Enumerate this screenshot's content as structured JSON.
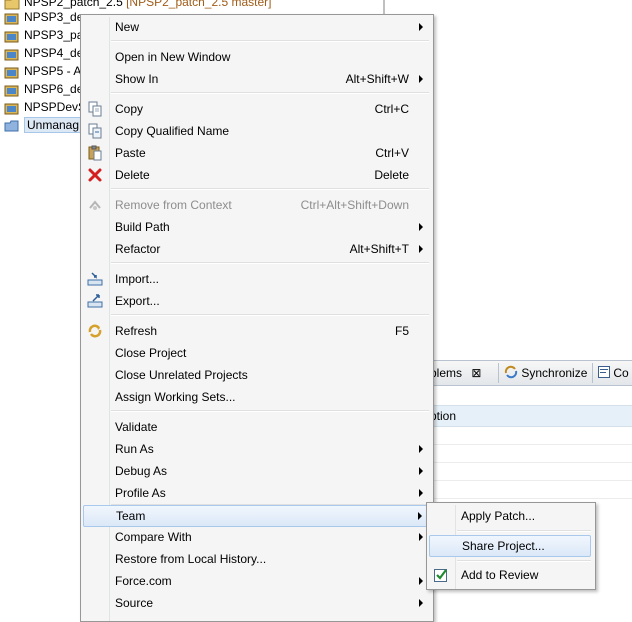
{
  "explorer": {
    "items": [
      {
        "label": "NPSP2_patch_2.5",
        "suffix": "[NPSP2_patch_2.5 master]"
      },
      {
        "label": "NPSP3_de"
      },
      {
        "label": "NPSP3_pa"
      },
      {
        "label": "NPSP4_de"
      },
      {
        "label": "NPSP5 - A"
      },
      {
        "label": "NPSP6_de"
      },
      {
        "label": "NPSPDevS"
      },
      {
        "label": "Unmanag"
      }
    ]
  },
  "bottom_panel": {
    "tabs": [
      {
        "label": "blems",
        "close": "⊠"
      },
      {
        "label": "Synchronize"
      },
      {
        "label": "Co"
      }
    ],
    "column_header": "ption"
  },
  "context_menu": {
    "items": [
      {
        "label": "New",
        "shortcut": "",
        "submenu": true
      },
      {
        "label": "Open in New Window",
        "shortcut": ""
      },
      {
        "label": "Show In",
        "shortcut": "Alt+Shift+W",
        "submenu": true
      },
      {
        "label": "Copy",
        "shortcut": "Ctrl+C",
        "icon": "copy-icon"
      },
      {
        "label": "Copy Qualified Name",
        "shortcut": "",
        "icon": "copy-qualified-name-icon"
      },
      {
        "label": "Paste",
        "shortcut": "Ctrl+V",
        "icon": "paste-icon"
      },
      {
        "label": "Delete",
        "shortcut": "Delete",
        "icon": "delete-icon"
      },
      {
        "label": "Remove from Context",
        "shortcut": "Ctrl+Alt+Shift+Down",
        "icon": "remove-context-icon",
        "disabled": true
      },
      {
        "label": "Build Path",
        "shortcut": "",
        "submenu": true
      },
      {
        "label": "Refactor",
        "shortcut": "Alt+Shift+T",
        "submenu": true
      },
      {
        "label": "Import...",
        "shortcut": "",
        "icon": "import-icon"
      },
      {
        "label": "Export...",
        "shortcut": "",
        "icon": "export-icon"
      },
      {
        "label": "Refresh",
        "shortcut": "F5",
        "icon": "refresh-icon"
      },
      {
        "label": "Close Project",
        "shortcut": ""
      },
      {
        "label": "Close Unrelated Projects",
        "shortcut": ""
      },
      {
        "label": "Assign Working Sets...",
        "shortcut": ""
      },
      {
        "label": "Validate",
        "shortcut": ""
      },
      {
        "label": "Run As",
        "shortcut": "",
        "submenu": true
      },
      {
        "label": "Debug As",
        "shortcut": "",
        "submenu": true
      },
      {
        "label": "Profile As",
        "shortcut": "",
        "submenu": true
      },
      {
        "label": "Team",
        "shortcut": "",
        "submenu": true,
        "highlighted": true
      },
      {
        "label": "Compare With",
        "shortcut": "",
        "submenu": true
      },
      {
        "label": "Restore from Local History...",
        "shortcut": ""
      },
      {
        "label": "Force.com",
        "shortcut": "",
        "submenu": true
      },
      {
        "label": "Source",
        "shortcut": "",
        "submenu": true
      }
    ]
  },
  "team_submenu": {
    "items": [
      {
        "label": "Apply Patch..."
      },
      {
        "label": "Share Project...",
        "highlighted": true
      },
      {
        "label": "Add to Review",
        "icon": "checkbox-checked-icon"
      }
    ]
  },
  "colors": {
    "menu_bg": "#f5f5f5",
    "menu_border": "#979797",
    "hover_bg": "#dbe8f8",
    "hover_border": "#a8c8ec",
    "disabled_text": "#8d8d8d"
  }
}
